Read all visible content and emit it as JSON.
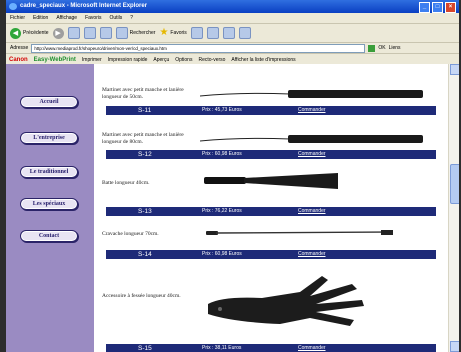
{
  "window": {
    "title": "cadre_speciaux - Microsoft Internet Explorer"
  },
  "menu": [
    "Fichier",
    "Edition",
    "Affichage",
    "Favoris",
    "Outils",
    "?"
  ],
  "toolbar": {
    "back_label": "Précédente",
    "search_label": "Rechercher",
    "favorites_label": "Favoris"
  },
  "address": {
    "label": "Adresse",
    "url": "http://www.mediaprod.fr/shopeuro/driver/mon-ver/cd_speciaux.htm",
    "go_label": "OK",
    "links_label": "Liens"
  },
  "canonbar": {
    "logo": "Canon",
    "product": "Easy-WebPrint",
    "buttons": [
      "Imprimer",
      "Impression rapide",
      "Aperçu",
      "Options",
      "Recto-verso",
      "Afficher la liste d'impressions"
    ]
  },
  "nav": [
    "Accueil",
    "L'entreprise",
    "Le traditionnel",
    "Les spéciaux",
    "Contact"
  ],
  "products": [
    {
      "desc": "Martinet avec petit manche et lanière longueur de 50cm.",
      "code": "S-11",
      "price": "Prix : 45,73 Euros",
      "order": "Commander"
    },
    {
      "desc": "Martinet avec petit manche et lanière longueur de 80cm.",
      "code": "S-12",
      "price": "Prix : 60,98 Euros",
      "order": "Commander"
    },
    {
      "desc": "Batte longueur 40cm.",
      "code": "S-13",
      "price": "Prix : 76,22 Euros",
      "order": "Commander"
    },
    {
      "desc": "Cravache longueur 70cm.",
      "code": "S-14",
      "price": "Prix : 60,98 Euros",
      "order": "Commander"
    },
    {
      "desc": "Accessoire à fessée longueur 40cm.",
      "code": "S-15",
      "price": "Prix : 38,11 Euros",
      "order": "Commander"
    }
  ]
}
